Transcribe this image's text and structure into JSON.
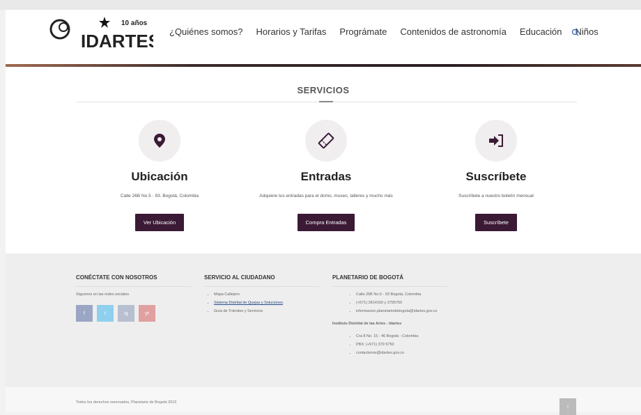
{
  "header": {
    "logo_anniversary": "10 años",
    "logo_brand": "IDARTES",
    "nav": [
      "¿Quiénes somos?",
      "Horarios y Tarifas",
      "Prográmate",
      "Contenidos de astronomía",
      "Educación",
      "Niños"
    ],
    "search_icon": "search-icon"
  },
  "services": {
    "title": "SERVICIOS",
    "cards": [
      {
        "icon": "map-marker-icon",
        "title": "Ubicación",
        "text": "Calle 26B No.5 - 93. Bogotá, Colombia",
        "button": "Ver Ubicación"
      },
      {
        "icon": "ticket-icon",
        "title": "Entradas",
        "text": "Adquiere tus entradas para el domo, museo, talleres y mucho más",
        "button": "Compra Entradas"
      },
      {
        "icon": "sign-in-icon",
        "title": "Suscríbete",
        "text": "Suscríbete a nuestro boletín mensual",
        "button": "Suscríbete"
      }
    ]
  },
  "footer": {
    "connect": {
      "title": "CONÉCTATE CON NOSOTROS",
      "text": "Síguenos en las redes sociales",
      "social": [
        "f",
        "t",
        "ig",
        "yt"
      ],
      "social_colors": [
        "#9aa6c4",
        "#8fd0ee",
        "#b7bfd0",
        "#e0a0a0"
      ]
    },
    "citizen": {
      "title": "SERVICIO AL CIUDADANO",
      "items": [
        "Mapa Callejero",
        "Sistema Distrital de Quejas y Soluciones",
        "Guía de Trámites y Servicios"
      ]
    },
    "planetario": {
      "title": "PLANETARIO DE BOGOTÁ",
      "items": [
        "Calle 26B No.5 - 93 Bogotá, Colombia",
        "(+571) 2814150 y 3795750",
        "informacion.planetariodebogota@idartes.gov.co"
      ],
      "subtitle": "Instituto Distrital de las Artes - Idartes",
      "items2": [
        "Cra 8 No. 15 - 46 Bogotá - Colombia",
        "PBX: (+571) 379 5750",
        "contactenos@idartes.gov.co"
      ]
    },
    "copyright": "Todos los derechos reservados, Planetario de Bogotá 2019",
    "totop": "↑"
  }
}
